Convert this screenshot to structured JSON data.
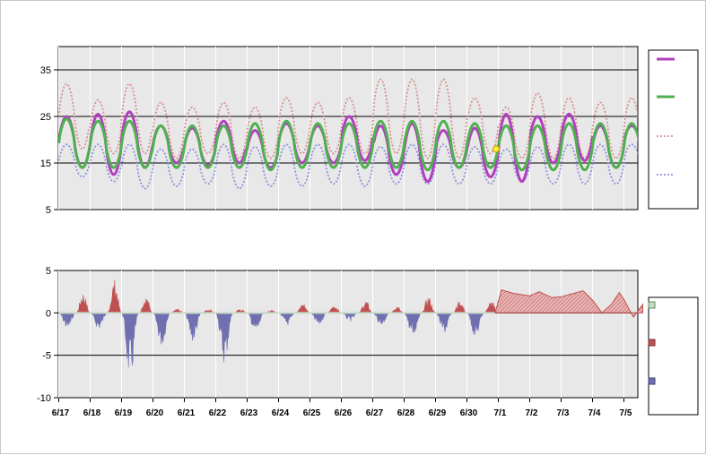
{
  "colors": {
    "plot_background": "#e8e8e8",
    "gridline": "#000000",
    "observed": "#b040c0",
    "forecast": "#50b050",
    "upper_bound": "#d89090",
    "lower_bound": "#9090e0",
    "positive_area": "#c05050",
    "negative_area": "#7070b0",
    "neutral_area": "#c8dcc8",
    "marker": "#ffee33"
  },
  "chart_data": [
    {
      "type": "line",
      "title": "",
      "xlabel": "",
      "ylabel": "",
      "ylim": [
        5,
        40
      ],
      "yticks": [
        5,
        15,
        25,
        35
      ],
      "grid": true,
      "legend_placement": "right",
      "x_tick_labels": [
        "6/17",
        "6/18",
        "6/19",
        "6/20",
        "6/21",
        "6/22",
        "6/23",
        "6/24",
        "6/25",
        "6/26",
        "6/27",
        "6/28",
        "6/29",
        "6/30",
        "7/1",
        "7/2",
        "7/3",
        "7/4",
        "7/5"
      ],
      "x_range_days": [
        0,
        18.6
      ],
      "forecast_start_day": 13.9,
      "daily_peak_day_offset": 0.25,
      "series": [
        {
          "key": "observed",
          "style": "solid-thick",
          "daily_max": [
            25.0,
            25.5,
            26.0,
            23.0,
            22.5,
            24.0,
            22.0,
            23.5,
            23.0,
            25.0,
            23.0,
            23.5,
            22.0,
            22.5,
            25.5,
            25.0,
            25.5,
            23.0,
            23.0
          ],
          "daily_min": [
            14.0,
            12.5,
            14.0,
            15.0,
            14.5,
            15.0,
            14.0,
            15.0,
            15.0,
            15.5,
            12.5,
            11.0,
            14.0,
            12.0,
            11.0,
            15.0,
            15.5,
            14.0,
            16.5
          ]
        },
        {
          "key": "forecast",
          "style": "solid-thick",
          "daily_max": [
            24.5,
            24.0,
            24.0,
            23.0,
            23.0,
            23.0,
            23.5,
            24.0,
            23.5,
            23.5,
            24.0,
            24.0,
            24.0,
            23.5,
            23.0,
            23.0,
            23.5,
            23.5,
            23.5
          ],
          "daily_min": [
            14.0,
            14.0,
            14.0,
            14.0,
            14.0,
            14.0,
            13.5,
            14.0,
            14.0,
            14.0,
            14.0,
            13.5,
            14.0,
            14.0,
            13.5,
            13.5,
            13.5,
            14.0,
            14.0
          ]
        },
        {
          "key": "upper_bound",
          "style": "dotted",
          "daily_max": [
            32.0,
            28.5,
            32.0,
            28.0,
            27.0,
            28.0,
            27.0,
            29.0,
            28.0,
            29.0,
            33.0,
            33.0,
            33.0,
            29.0,
            27.0,
            30.0,
            29.0,
            28.0,
            29.0
          ],
          "daily_min": [
            18.0,
            17.0,
            17.0,
            16.0,
            17.0,
            16.0,
            16.0,
            17.0,
            17.0,
            17.0,
            17.0,
            16.0,
            16.0,
            17.0,
            16.0,
            16.0,
            16.0,
            16.0,
            16.0
          ]
        },
        {
          "key": "lower_bound",
          "style": "dotted",
          "daily_max": [
            19.0,
            19.0,
            19.0,
            18.0,
            18.0,
            19.0,
            18.5,
            19.0,
            19.0,
            19.0,
            18.5,
            19.0,
            19.0,
            18.5,
            18.0,
            18.5,
            19.0,
            19.0,
            19.0
          ],
          "daily_min": [
            12.0,
            11.0,
            9.5,
            10.0,
            10.5,
            9.5,
            10.0,
            10.0,
            10.5,
            10.0,
            10.5,
            10.5,
            10.5,
            10.5,
            11.0,
            10.5,
            10.5,
            10.5,
            12.5
          ]
        }
      ],
      "marker": {
        "day": 13.93,
        "value": 18
      }
    },
    {
      "type": "area",
      "title": "",
      "xlabel": "",
      "ylabel": "",
      "ylim": [
        -10,
        5
      ],
      "yticks": [
        -10,
        -5,
        0,
        5
      ],
      "grid": true,
      "legend_placement": "right",
      "x_tick_labels": [
        "6/17",
        "6/18",
        "6/19",
        "6/20",
        "6/21",
        "6/22",
        "6/23",
        "6/24",
        "6/25",
        "6/26",
        "6/27",
        "6/28",
        "6/29",
        "6/30",
        "7/1",
        "7/2",
        "7/3",
        "7/4",
        "7/5"
      ],
      "x_range_days": [
        0,
        18.6
      ],
      "forecast_start_day": 13.9,
      "series": [
        {
          "key": "observed_difference",
          "style": "spiky",
          "daily_pos": [
            2.5,
            4.0,
            2.0,
            0.5,
            0.5,
            0.5,
            0.3,
            1.2,
            1.0,
            1.5,
            1.0,
            2.0,
            1.5,
            1.5
          ],
          "daily_neg": [
            2.0,
            2.0,
            8.0,
            4.0,
            3.5,
            6.0,
            2.5,
            1.5,
            1.5,
            1.0,
            1.5,
            3.0,
            2.5,
            3.0
          ]
        },
        {
          "key": "forecast_difference",
          "style": "smooth",
          "x": [
            13.9,
            14.1,
            14.5,
            15.0,
            15.3,
            15.7,
            16.0,
            16.3,
            16.7,
            17.0,
            17.3,
            17.6,
            17.85,
            18.0,
            18.3,
            18.6
          ],
          "values": [
            0.0,
            2.7,
            2.3,
            2.0,
            2.5,
            1.8,
            1.9,
            2.2,
            2.6,
            1.5,
            0.0,
            1.0,
            2.4,
            1.6,
            -0.5,
            1.0
          ]
        }
      ]
    }
  ]
}
